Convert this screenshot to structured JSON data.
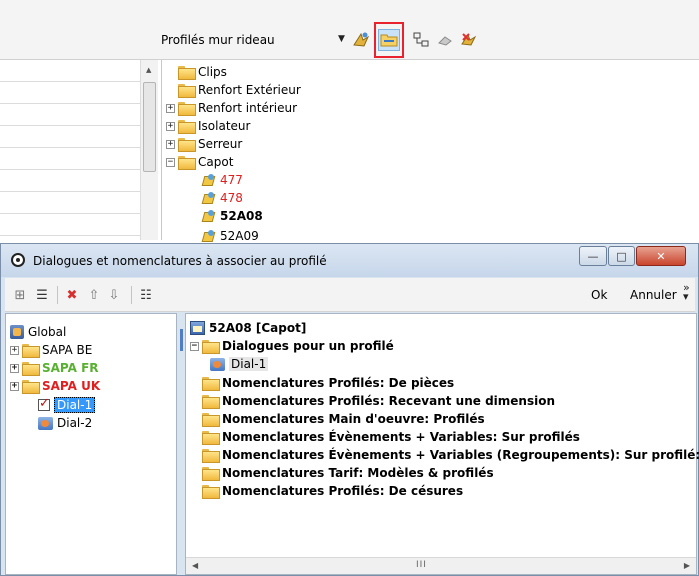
{
  "top_toolbar": {
    "profile_select_value": "Profilés mur rideau"
  },
  "background_tree": {
    "items": [
      {
        "label": "Clips"
      },
      {
        "label": "Renfort Extérieur"
      },
      {
        "label": "Renfort intérieur"
      },
      {
        "label": "Isolateur"
      },
      {
        "label": "Serreur"
      },
      {
        "label": "Capot"
      },
      {
        "label": "477"
      },
      {
        "label": "478"
      },
      {
        "label": "52A08"
      },
      {
        "label": "52A09"
      }
    ]
  },
  "dialog": {
    "title": "Dialogues et nomenclatures à associer au profilé",
    "ok_label": "Ok",
    "cancel_label": "Annuler",
    "left_tree": [
      {
        "label": "Global"
      },
      {
        "label": "SAPA BE"
      },
      {
        "label": "SAPA FR"
      },
      {
        "label": "SAPA UK"
      },
      {
        "label": "Dial-1"
      },
      {
        "label": "Dial-2"
      }
    ],
    "right_tree": {
      "root": "52A08 [Capot]",
      "items": [
        {
          "label": "Dialogues pour un profilé"
        },
        {
          "label": "Dial-1"
        },
        {
          "label": "Nomenclatures Profilés: De pièces"
        },
        {
          "label": "Nomenclatures Profilés: Recevant une dimension"
        },
        {
          "label": "Nomenclatures Main d'oeuvre: Profilés"
        },
        {
          "label": "Nomenclatures Évènements + Variables: Sur profilés"
        },
        {
          "label": "Nomenclatures Évènements + Variables (Regroupements): Sur profilé:"
        },
        {
          "label": "Nomenclatures Tarif: Modèles & profilés"
        },
        {
          "label": "Nomenclatures Profilés: De césures"
        }
      ]
    }
  },
  "colors": {
    "highlight_border": "#e8232f",
    "red_text": "#e02020",
    "green_text": "#58b030",
    "selection": "#3399ff"
  }
}
